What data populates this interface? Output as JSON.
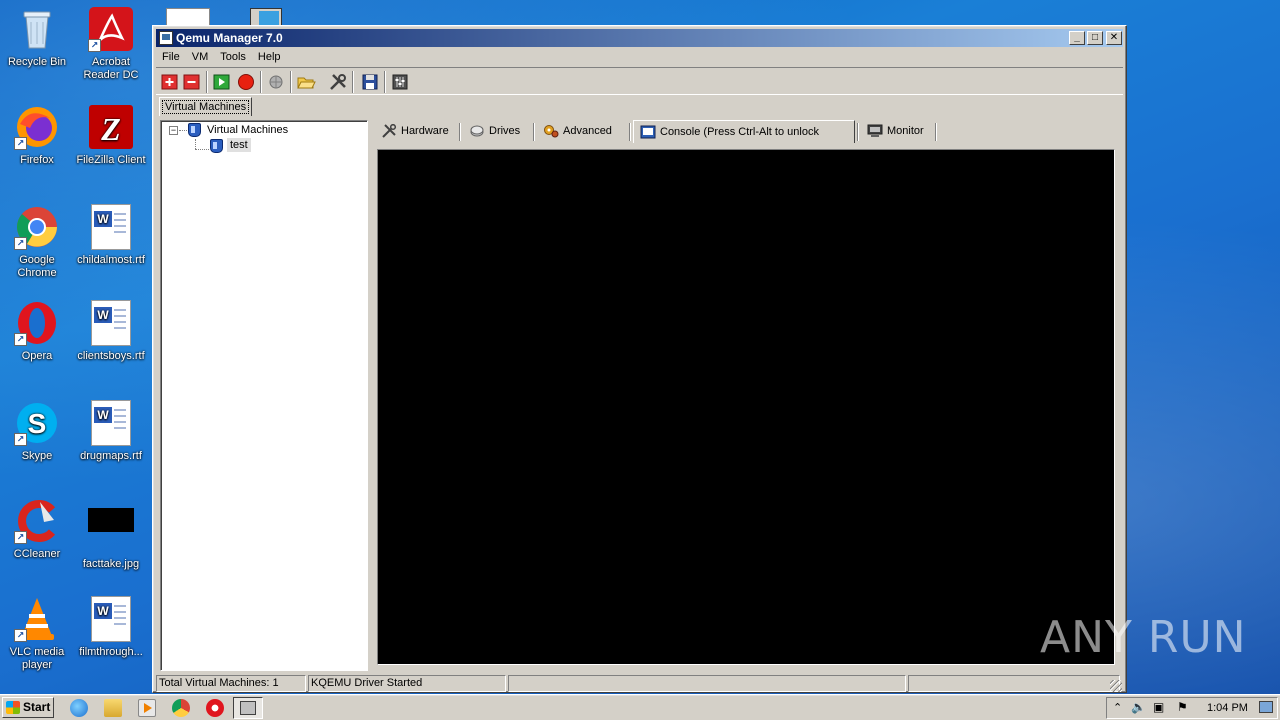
{
  "desktop": {
    "icons": [
      {
        "label": "Recycle Bin",
        "icon": "recycle-bin-icon"
      },
      {
        "label": "Acrobat Reader DC",
        "icon": "acrobat-icon"
      },
      {
        "label": "Firefox",
        "icon": "firefox-icon"
      },
      {
        "label": "FileZilla Client",
        "icon": "filezilla-icon"
      },
      {
        "label": "Google Chrome",
        "icon": "chrome-icon"
      },
      {
        "label": "childalmost.rtf",
        "icon": "word-document-icon"
      },
      {
        "label": "Opera",
        "icon": "opera-icon"
      },
      {
        "label": "clientsboys.rtf",
        "icon": "word-document-icon"
      },
      {
        "label": "Skype",
        "icon": "skype-icon"
      },
      {
        "label": "drugmaps.rtf",
        "icon": "word-document-icon"
      },
      {
        "label": "CCleaner",
        "icon": "ccleaner-icon"
      },
      {
        "label": "facttake.jpg",
        "icon": "image-file-icon"
      },
      {
        "label": "VLC media player",
        "icon": "vlc-icon"
      },
      {
        "label": "filmthrough...",
        "icon": "word-document-icon"
      }
    ]
  },
  "window": {
    "title": "Qemu Manager 7.0",
    "menu": [
      "File",
      "VM",
      "Tools",
      "Help"
    ],
    "main_tab": "Virtual Machines",
    "tree": {
      "root": "Virtual Machines",
      "children": [
        "test"
      ]
    },
    "tabs": [
      {
        "label": "Hardware",
        "icon": "hardware-tools-icon"
      },
      {
        "label": "Drives",
        "icon": "drives-icon"
      },
      {
        "label": "Advanced",
        "icon": "advanced-gears-icon"
      },
      {
        "label": "Console (Press Ctrl-Alt to unlock mouse)",
        "icon": "console-icon",
        "active": true
      },
      {
        "label": "Monitor",
        "icon": "monitor-icon"
      }
    ],
    "status": {
      "vm_count": "Total Virtual Machines: 1",
      "driver": "KQEMU Driver Started",
      "panel3": "",
      "panel4": ""
    }
  },
  "taskbar": {
    "start_label": "Start",
    "clock": "1:04 PM"
  },
  "watermark": "ANY RUN",
  "colors": {
    "desktop": "#1a6fcf",
    "title_gradient_start": "#0a246a",
    "title_gradient_end": "#a6caf0",
    "chrome": "#d4d0c8",
    "console": "#000000"
  }
}
